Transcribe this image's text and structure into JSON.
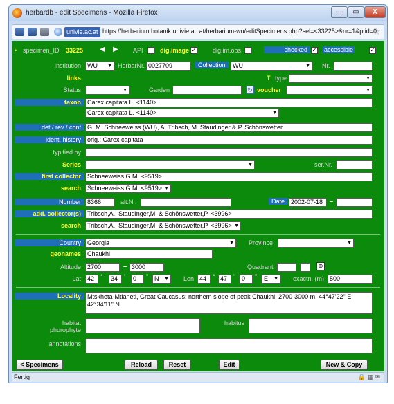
{
  "window": {
    "title": "herbardb - edit Specimens - Mozilla Firefox",
    "minimize": "—",
    "maximize": "▭",
    "close": "X"
  },
  "navbar": {
    "domain": "univie.ac.at",
    "url": "https://herbarium.botanik.univie.ac.at/herbarium-wu/editSpecimens.php?sel=<33225>&nr=1&ptid=0"
  },
  "form": {
    "specimen_label": "specimen_ID",
    "specimen_id": "33225",
    "prev_arrow": "◀",
    "next_arrow": "▶",
    "api_label": "API",
    "dig_image_label": "dig.image",
    "dig_image_checked": "✓",
    "dig_im_obs_label": "dig.im.obs.",
    "checked_label": "checked",
    "checked_mark": "✓",
    "accessible_label": "accessible",
    "accessible_mark": "✓",
    "institution_label": "Institution",
    "institution_value": "WU",
    "herbarnr_label": "HerbarNr.",
    "herbarnr_value": "0027709",
    "collection_label": "Collection",
    "collection_value": "WU",
    "nr_label": "Nr.",
    "links_label": "links",
    "t_label": "T",
    "type_label": "type",
    "status_label": "Status",
    "garden_label": "Garden",
    "voucher_label": "voucher",
    "taxon_label": "taxon",
    "taxon_text": "Carex capitata L. <1140>",
    "taxon_select": "Carex capitata L. <1140>",
    "det_label": "det / rev / conf",
    "det_value": "G. M. Schneeweiss (WU), A. Tribsch, M. Staudinger & P. Schönswetter",
    "ident_history_label": "ident. history",
    "ident_history_value": "orig.: Carex capitata",
    "typified_by_label": "typified by",
    "series_label": "Series",
    "sernr_label": "ser.Nr.",
    "first_collector_label": "first collector",
    "first_collector_value": "Schneeweiss,G.M. <9519>",
    "search_label": "search",
    "first_collector_search": "Schneeweiss,G.M. <9519>",
    "number_label": "Number",
    "number_value": "8366",
    "altnr_label": "alt.Nr.",
    "date_label": "Date",
    "date_value": "2002-07-18",
    "date_dash": "–",
    "add_collectors_label": "add. collector(s)",
    "add_collectors_value": "Tribsch,A., Staudinger,M. & Schönswetter,P. <3996>",
    "search2_label": "search",
    "add_collectors_search": "Tribsch,A., Staudinger,M. & Schönswetter,P. <3996>",
    "country_label": "Country",
    "country_value": "Georgia",
    "province_label": "Province",
    "geonames_label": "geonames",
    "geonames_value": "Chaukhi",
    "altitude_label": "Altitude",
    "altitude_min": "2700",
    "altitude_dash": "–",
    "altitude_max": "3000",
    "quadrant_label": "Quadrant",
    "lat_label": "Lat",
    "lat_deg": "42",
    "lat_min": "34",
    "lat_sec": "0",
    "lat_hemi": "N",
    "lon_label": "Lon",
    "lon_deg": "44",
    "lon_min": "47",
    "lon_sec": "0",
    "lon_hemi": "E",
    "exactn_label": "exactn. (m)",
    "exactn_value": "500",
    "locality_label": "Locality",
    "locality_value": "Mtskheta-Mtianeti, Great Caucasus: northern slope of peak Chaukhi; 2700-3000 m. 44°47'22\" E, 42°34'11\" N.",
    "habitat_label": "habitat",
    "phorophyte_label": "phorophyte",
    "habitus_label": "habitus",
    "annotations_label": "annotations"
  },
  "buttons": {
    "specimens": "< Specimens",
    "reload": "Reload",
    "reset": "Reset",
    "edit": "Edit",
    "new_copy": "New & Copy"
  },
  "statusbar": {
    "text": "Fertig"
  }
}
